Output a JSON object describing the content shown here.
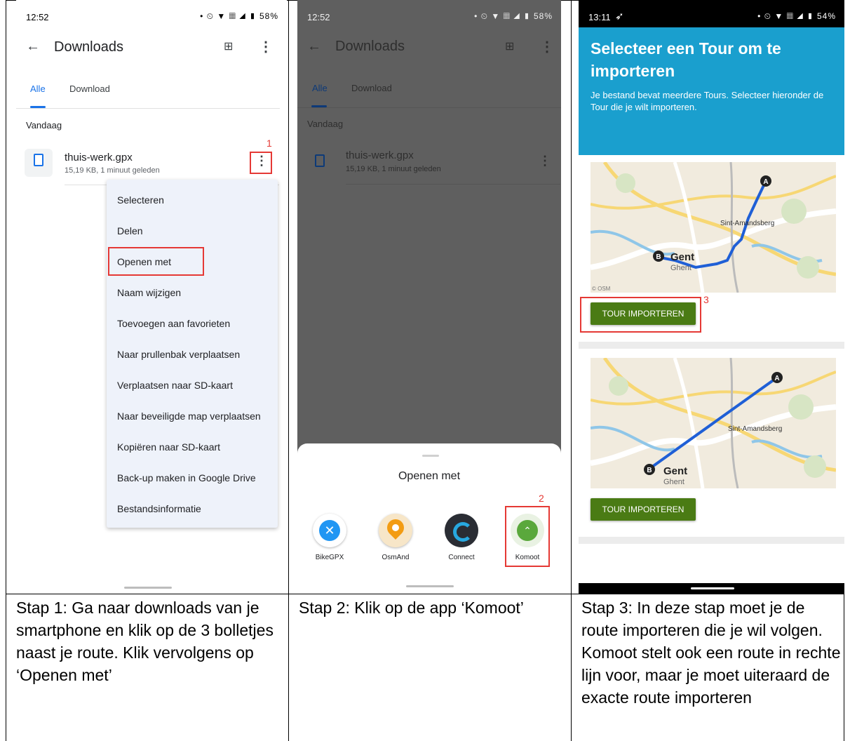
{
  "panel1": {
    "status_time": "12:52",
    "status_right": "• ⏲ ▼ ▦ ◢ ▮ 58%",
    "title": "Downloads",
    "tabs": [
      "Alle",
      "Download"
    ],
    "section": "Vandaag",
    "file_name": "thuis-werk.gpx",
    "file_meta": "15,19 KB, 1 minuut geleden",
    "step_marker": "1",
    "menu": [
      "Selecteren",
      "Delen",
      "Openen met",
      "Naam wijzigen",
      "Toevoegen aan favorieten",
      "Naar prullenbak verplaatsen",
      "Verplaatsen naar SD-kaart",
      "Naar beveiligde map verplaatsen",
      "Kopiëren naar SD-kaart",
      "Back-up maken in Google Drive",
      "Bestandsinformatie"
    ]
  },
  "panel2": {
    "status_time": "12:52",
    "status_right": "• ⏲ ▼ ▦ ◢ ▮ 58%",
    "title": "Downloads",
    "tabs": [
      "Alle",
      "Download"
    ],
    "section": "Vandaag",
    "file_name": "thuis-werk.gpx",
    "file_meta": "15,19 KB, 1 minuut geleden",
    "sheet_title": "Openen met",
    "step_marker": "2",
    "apps": [
      "BikeGPX",
      "OsmAnd",
      "Connect",
      "Komoot"
    ],
    "app_colors": [
      "#2196f3",
      "#f39c12",
      "#2a2d34",
      "#5aa83c"
    ]
  },
  "panel3": {
    "status_time": "13:11",
    "status_right": "• ⏲ ▼ ▦ ◢ ▮ 54%",
    "title": "Selecteer een Tour om te importeren",
    "subtitle": "Je bestand bevat meerdere Tours. Selecteer hieronder de Tour die je wilt importeren.",
    "button_label": "TOUR IMPORTEREN",
    "step_marker": "3",
    "map1": {
      "place_small": "Sint-Amandsberg",
      "place_big": "Gent",
      "place_sub": "Ghent",
      "copyright": "© OSM",
      "start": "A",
      "end": "B"
    },
    "map2": {
      "place_small": "Sint-Amandsberg",
      "place_big": "Gent",
      "place_sub": "Ghent",
      "start": "A",
      "end": "B"
    },
    "route_color": "#1f5fd6",
    "button_color": "#4a7b14",
    "header_color": "#1a9fce"
  },
  "captions": [
    "Stap 1: Ga naar downloads van je smartphone en klik op de 3 bolletjes naast je route. Klik vervolgens op ‘Openen met’",
    "Stap 2: Klik op de app ‘Komoot’",
    "Stap 3: In deze stap moet je de route importeren die je wil volgen. Komoot stelt ook een route in rechte lijn voor, maar je moet uiteraard de exacte route importeren"
  ]
}
